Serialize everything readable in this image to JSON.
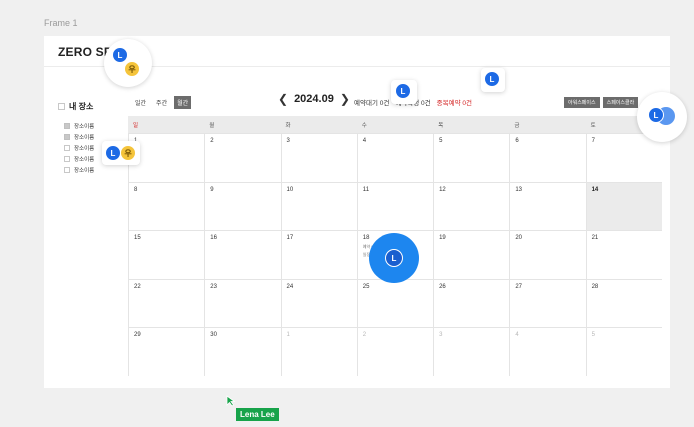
{
  "frame_label": "Frame 1",
  "app_title": "ZERO SPA",
  "sidebar": {
    "title": "내 장소",
    "places": [
      {
        "label": "장소이름",
        "checked": true
      },
      {
        "label": "장소이름",
        "checked": true
      },
      {
        "label": "장소이름",
        "checked": false
      },
      {
        "label": "장소이름",
        "checked": false
      },
      {
        "label": "장소이름",
        "checked": false
      }
    ]
  },
  "view_tabs": [
    {
      "label": "일간",
      "active": false
    },
    {
      "label": "주간",
      "active": false
    },
    {
      "label": "월간",
      "active": true
    }
  ],
  "month_nav": {
    "prev": "❮",
    "current": "2024.09",
    "next": "❯"
  },
  "stats": {
    "pending": "예약대기 0건",
    "confirmed": "예약확정 0건",
    "duplicate": "중복예약 0건"
  },
  "space_buttons": [
    "아워스페이스",
    "스페이스클라"
  ],
  "calendar": {
    "weekdays": [
      "일",
      "월",
      "화",
      "수",
      "목",
      "금",
      "토"
    ],
    "weeks": [
      [
        "1",
        "2",
        "3",
        "4",
        "5",
        "6",
        "7"
      ],
      [
        "8",
        "9",
        "10",
        "11",
        "12",
        "13",
        "14"
      ],
      [
        "15",
        "16",
        "17",
        "18",
        "19",
        "20",
        "21"
      ],
      [
        "22",
        "23",
        "24",
        "25",
        "26",
        "27",
        "28"
      ],
      [
        "29",
        "30",
        "1",
        "2",
        "3",
        "4",
        "5"
      ]
    ],
    "events": {
      "18": [
        "예약 09:00",
        "일정 09:00"
      ]
    }
  },
  "avatars": {
    "l": "L",
    "woo": "우"
  },
  "cursor_user": "Lena Lee",
  "colors": {
    "accent_blue": "#1d6ae5",
    "danger": "#d42424",
    "cursor_green": "#17a34a"
  }
}
